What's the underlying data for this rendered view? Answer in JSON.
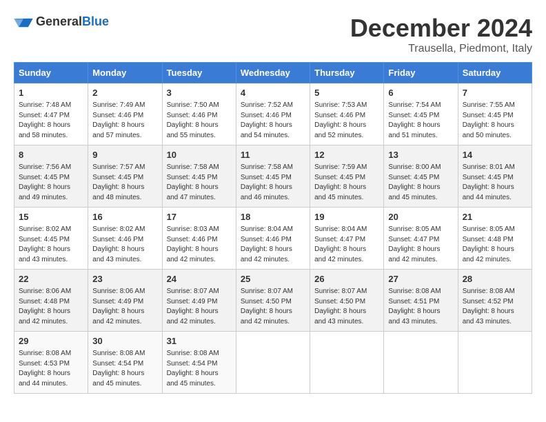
{
  "header": {
    "logo_general": "General",
    "logo_blue": "Blue",
    "month": "December 2024",
    "location": "Trausella, Piedmont, Italy"
  },
  "columns": [
    "Sunday",
    "Monday",
    "Tuesday",
    "Wednesday",
    "Thursday",
    "Friday",
    "Saturday"
  ],
  "weeks": [
    [
      {
        "day": "1",
        "sunrise": "7:48 AM",
        "sunset": "4:47 PM",
        "daylight": "8 hours and 58 minutes."
      },
      {
        "day": "2",
        "sunrise": "7:49 AM",
        "sunset": "4:46 PM",
        "daylight": "8 hours and 57 minutes."
      },
      {
        "day": "3",
        "sunrise": "7:50 AM",
        "sunset": "4:46 PM",
        "daylight": "8 hours and 55 minutes."
      },
      {
        "day": "4",
        "sunrise": "7:52 AM",
        "sunset": "4:46 PM",
        "daylight": "8 hours and 54 minutes."
      },
      {
        "day": "5",
        "sunrise": "7:53 AM",
        "sunset": "4:46 PM",
        "daylight": "8 hours and 52 minutes."
      },
      {
        "day": "6",
        "sunrise": "7:54 AM",
        "sunset": "4:45 PM",
        "daylight": "8 hours and 51 minutes."
      },
      {
        "day": "7",
        "sunrise": "7:55 AM",
        "sunset": "4:45 PM",
        "daylight": "8 hours and 50 minutes."
      }
    ],
    [
      {
        "day": "8",
        "sunrise": "7:56 AM",
        "sunset": "4:45 PM",
        "daylight": "8 hours and 49 minutes."
      },
      {
        "day": "9",
        "sunrise": "7:57 AM",
        "sunset": "4:45 PM",
        "daylight": "8 hours and 48 minutes."
      },
      {
        "day": "10",
        "sunrise": "7:58 AM",
        "sunset": "4:45 PM",
        "daylight": "8 hours and 47 minutes."
      },
      {
        "day": "11",
        "sunrise": "7:58 AM",
        "sunset": "4:45 PM",
        "daylight": "8 hours and 46 minutes."
      },
      {
        "day": "12",
        "sunrise": "7:59 AM",
        "sunset": "4:45 PM",
        "daylight": "8 hours and 45 minutes."
      },
      {
        "day": "13",
        "sunrise": "8:00 AM",
        "sunset": "4:45 PM",
        "daylight": "8 hours and 45 minutes."
      },
      {
        "day": "14",
        "sunrise": "8:01 AM",
        "sunset": "4:45 PM",
        "daylight": "8 hours and 44 minutes."
      }
    ],
    [
      {
        "day": "15",
        "sunrise": "8:02 AM",
        "sunset": "4:45 PM",
        "daylight": "8 hours and 43 minutes."
      },
      {
        "day": "16",
        "sunrise": "8:02 AM",
        "sunset": "4:46 PM",
        "daylight": "8 hours and 43 minutes."
      },
      {
        "day": "17",
        "sunrise": "8:03 AM",
        "sunset": "4:46 PM",
        "daylight": "8 hours and 42 minutes."
      },
      {
        "day": "18",
        "sunrise": "8:04 AM",
        "sunset": "4:46 PM",
        "daylight": "8 hours and 42 minutes."
      },
      {
        "day": "19",
        "sunrise": "8:04 AM",
        "sunset": "4:47 PM",
        "daylight": "8 hours and 42 minutes."
      },
      {
        "day": "20",
        "sunrise": "8:05 AM",
        "sunset": "4:47 PM",
        "daylight": "8 hours and 42 minutes."
      },
      {
        "day": "21",
        "sunrise": "8:05 AM",
        "sunset": "4:48 PM",
        "daylight": "8 hours and 42 minutes."
      }
    ],
    [
      {
        "day": "22",
        "sunrise": "8:06 AM",
        "sunset": "4:48 PM",
        "daylight": "8 hours and 42 minutes."
      },
      {
        "day": "23",
        "sunrise": "8:06 AM",
        "sunset": "4:49 PM",
        "daylight": "8 hours and 42 minutes."
      },
      {
        "day": "24",
        "sunrise": "8:07 AM",
        "sunset": "4:49 PM",
        "daylight": "8 hours and 42 minutes."
      },
      {
        "day": "25",
        "sunrise": "8:07 AM",
        "sunset": "4:50 PM",
        "daylight": "8 hours and 42 minutes."
      },
      {
        "day": "26",
        "sunrise": "8:07 AM",
        "sunset": "4:50 PM",
        "daylight": "8 hours and 43 minutes."
      },
      {
        "day": "27",
        "sunrise": "8:08 AM",
        "sunset": "4:51 PM",
        "daylight": "8 hours and 43 minutes."
      },
      {
        "day": "28",
        "sunrise": "8:08 AM",
        "sunset": "4:52 PM",
        "daylight": "8 hours and 43 minutes."
      }
    ],
    [
      {
        "day": "29",
        "sunrise": "8:08 AM",
        "sunset": "4:53 PM",
        "daylight": "8 hours and 44 minutes."
      },
      {
        "day": "30",
        "sunrise": "8:08 AM",
        "sunset": "4:54 PM",
        "daylight": "8 hours and 45 minutes."
      },
      {
        "day": "31",
        "sunrise": "8:08 AM",
        "sunset": "4:54 PM",
        "daylight": "8 hours and 45 minutes."
      },
      null,
      null,
      null,
      null
    ]
  ],
  "labels": {
    "sunrise": "Sunrise:",
    "sunset": "Sunset:",
    "daylight": "Daylight:"
  }
}
